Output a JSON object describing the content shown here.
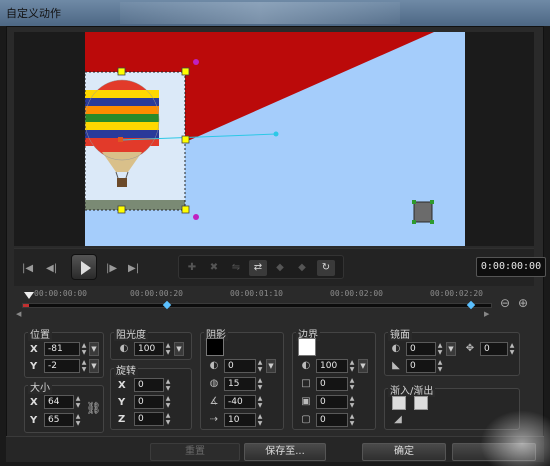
{
  "window": {
    "title": "自定义动作"
  },
  "playback": {
    "timecode": "0:00:00:00",
    "buttons": [
      "to-start",
      "prev-frame",
      "play",
      "next-frame",
      "to-end"
    ]
  },
  "timeline": {
    "ticks": [
      "00:00:00:00",
      "00:00:00:20",
      "00:00:01:10",
      "00:00:02:00",
      "00:00:02:20"
    ]
  },
  "position": {
    "label": "位置",
    "x": "-81",
    "y": "-2"
  },
  "size": {
    "label": "大小",
    "x": "64",
    "y": "65"
  },
  "opacity": {
    "label": "阻光度",
    "value": "100"
  },
  "rotation": {
    "label": "旋转",
    "x": "0",
    "y": "0",
    "z": "0"
  },
  "shadow": {
    "label": "阴影",
    "color": "#000000",
    "v1": "0",
    "v2": "15",
    "v3": "-40",
    "v4": "10"
  },
  "border": {
    "label": "边界",
    "color": "#ffffff",
    "v1": "100",
    "v2": "0",
    "v3": "0",
    "v4": "0"
  },
  "mirror": {
    "label": "镜面",
    "v1": "0",
    "v2": "0",
    "v3": "0"
  },
  "fade": {
    "label": "渐入/渐出"
  },
  "axis_labels": {
    "x": "X",
    "y": "Y",
    "z": "Z"
  },
  "footer": {
    "reset": "重置",
    "save_to": "保存至...",
    "ok": "确定"
  }
}
